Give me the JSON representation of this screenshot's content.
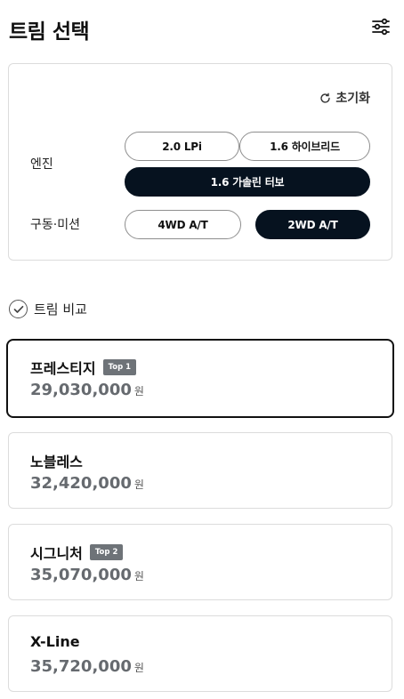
{
  "header": {
    "title": "트림 선택"
  },
  "options": {
    "reset_label": "초기화",
    "engine": {
      "label": "엔진",
      "choices": [
        "2.0 LPi",
        "1.6 하이브리드",
        "1.6 가솔린 터보"
      ],
      "selected": "1.6 가솔린 터보"
    },
    "drivetrain": {
      "label": "구동·미션",
      "choices": [
        "4WD A/T",
        "2WD A/T"
      ],
      "selected": "2WD A/T"
    }
  },
  "compare": {
    "label": "트림 비교"
  },
  "trims": [
    {
      "name": "프레스티지",
      "badge": "Top 1",
      "price": "29,030,000",
      "unit": "원",
      "selected": true
    },
    {
      "name": "노블레스",
      "badge": "",
      "price": "32,420,000",
      "unit": "원",
      "selected": false
    },
    {
      "name": "시그니처",
      "badge": "Top 2",
      "price": "35,070,000",
      "unit": "원",
      "selected": false
    },
    {
      "name": "X-Line",
      "badge": "",
      "price": "35,720,000",
      "unit": "원",
      "selected": false
    }
  ],
  "colors": {
    "selected_dark": "#06121f",
    "badge_gray": "#6e7378",
    "price_gray": "#666a6f"
  }
}
